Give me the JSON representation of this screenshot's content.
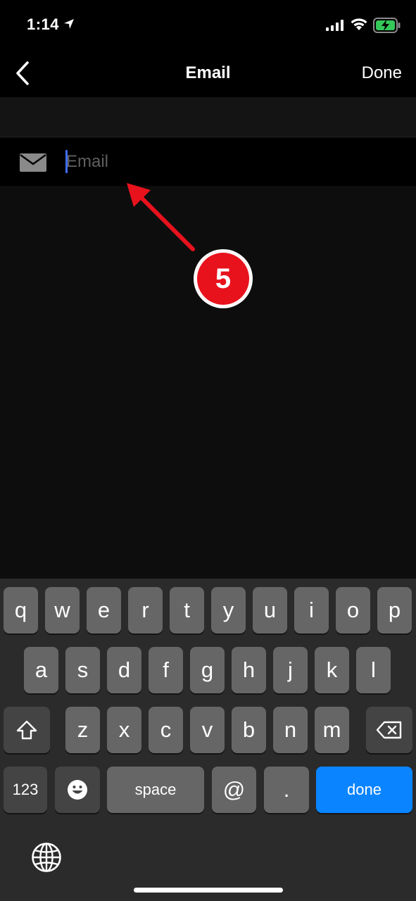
{
  "status_bar": {
    "time": "1:14"
  },
  "nav": {
    "title": "Email",
    "done_label": "Done"
  },
  "email_field": {
    "placeholder": "Email",
    "value": ""
  },
  "annotation": {
    "step": "5",
    "color": "#e8121d"
  },
  "keyboard": {
    "row1": [
      "q",
      "w",
      "e",
      "r",
      "t",
      "y",
      "u",
      "i",
      "o",
      "p"
    ],
    "row2": [
      "a",
      "s",
      "d",
      "f",
      "g",
      "h",
      "j",
      "k",
      "l"
    ],
    "row3": [
      "z",
      "x",
      "c",
      "v",
      "b",
      "n",
      "m"
    ],
    "numbers_label": "123",
    "space_label": "space",
    "at_label": "@",
    "period_label": ".",
    "done_label": "done",
    "done_color": "#0a84ff"
  }
}
